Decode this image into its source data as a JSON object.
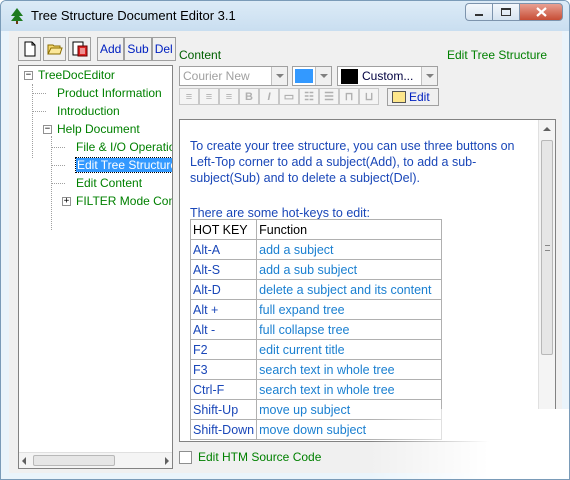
{
  "window": {
    "title": "Tree Structure Document Editor 3.1",
    "controls": {
      "minimize": "minimize",
      "maximize": "maximize",
      "close": "close"
    }
  },
  "toolbar": {
    "add_label": "Add",
    "sub_label": "Sub",
    "del_label": "Del"
  },
  "tree": {
    "root": "TreeDocEditor",
    "items": [
      {
        "label": "Product Information"
      },
      {
        "label": "Introduction"
      },
      {
        "label": "Help Document"
      },
      {
        "label": "File & I/O Operations"
      },
      {
        "label": "Edit Tree Structure"
      },
      {
        "label": "Edit Content"
      },
      {
        "label": "FILTER Mode Commands"
      }
    ]
  },
  "content": {
    "label": "Content",
    "section_title": "Edit Tree Structure",
    "font": "Courier New",
    "color_label": "Custom...",
    "edit_label": "Edit",
    "paragraph": "To create your tree structure, you can use three buttons on Left-Top corner to add a subject(Add), to add a sub-subject(Sub) and to delete a subject(Del).",
    "hotkeys_intro": "There are some hot-keys to edit:",
    "table": {
      "headers": [
        "HOT KEY",
        "Function"
      ],
      "rows": [
        [
          "Alt-A",
          "add a subject"
        ],
        [
          "Alt-S",
          "add a sub subject"
        ],
        [
          "Alt-D",
          "delete a subject and its content"
        ],
        [
          "Alt +",
          "full expand tree"
        ],
        [
          "Alt -",
          "full collapse tree"
        ],
        [
          "F2",
          "edit current title"
        ],
        [
          "F3",
          "search text in whole tree"
        ],
        [
          "Ctrl-F",
          "search text in whole tree"
        ],
        [
          "Shift-Up",
          "move up subject"
        ],
        [
          "Shift-Down",
          "move down subject"
        ]
      ]
    },
    "html_source_checkbox": "Edit HTM Source Code"
  },
  "colors": {
    "tree_text": "#008000",
    "selection": "#3399ff",
    "editor_text": "#1a47b8",
    "toolbar_text": "#0020c0"
  }
}
